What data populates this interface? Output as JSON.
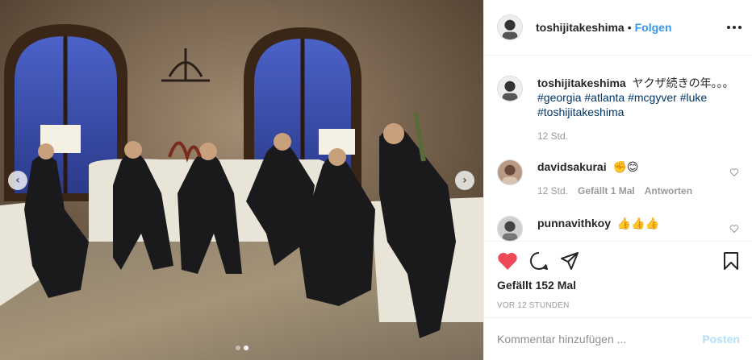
{
  "post": {
    "username": "toshijitakeshima",
    "follow_label": "Folgen",
    "separator": "•",
    "caption": {
      "username": "toshijitakeshima",
      "text": "ヤクザ続きの年。。。",
      "hashtags": [
        "#georgia",
        "#atlanta",
        "#mcgyver",
        "#luke",
        "#toshijitakeshima"
      ],
      "time": "12 Std."
    },
    "comments": [
      {
        "username": "davidsakurai",
        "text": "✊😊",
        "time": "12 Std.",
        "likes": "Gefällt 1 Mal",
        "reply": "Antworten"
      },
      {
        "username": "punnavithkoy",
        "text": "👍👍👍"
      }
    ],
    "likes_label": "Gefällt 152 Mal",
    "timestamp": "VOR 12 STUNDEN",
    "comment_placeholder": "Kommentar hinzufügen ...",
    "post_button": "Posten",
    "carousel": {
      "count": 2,
      "active": 1
    },
    "colors": {
      "accent": "#3897f0",
      "like_red": "#ed4956",
      "hashtag": "#003569",
      "muted": "#999999"
    }
  }
}
